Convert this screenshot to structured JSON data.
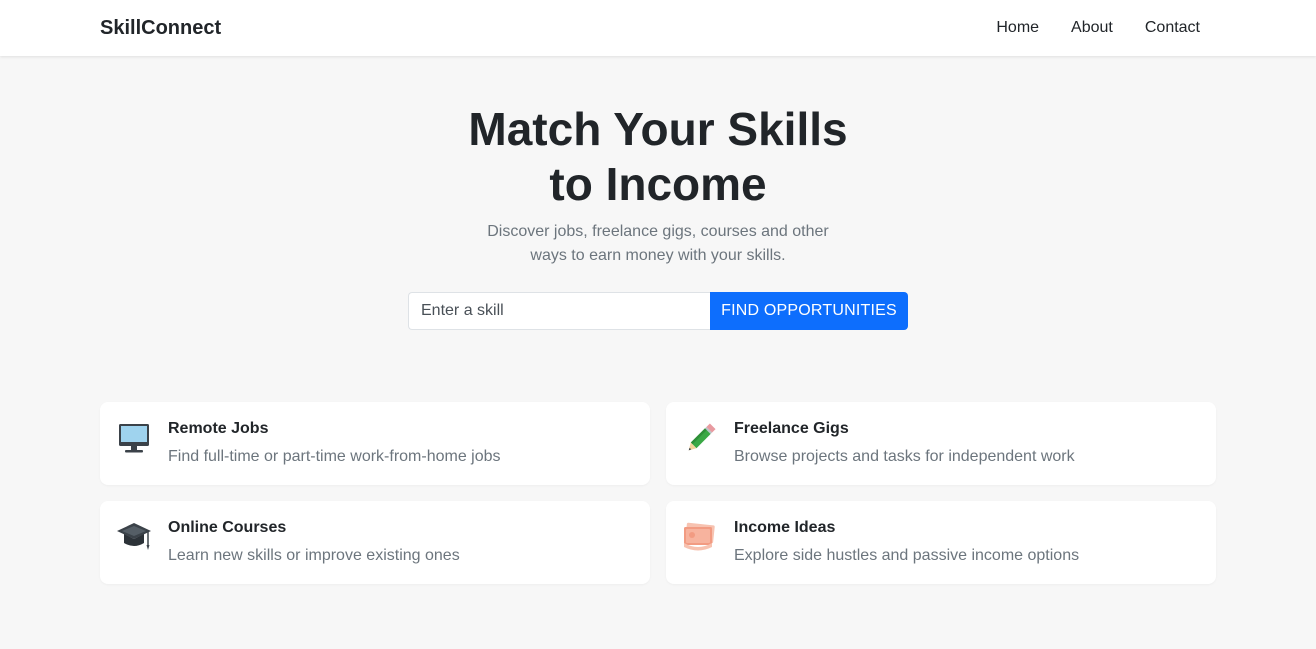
{
  "nav": {
    "brand": "SkillConnect",
    "links": [
      "Home",
      "About",
      "Contact"
    ]
  },
  "hero": {
    "title_line1": "Match Your Skills",
    "title_line2": "to Income",
    "subtitle_line1": "Discover jobs, freelance gigs, courses and other",
    "subtitle_line2": "ways to earn money with your skills."
  },
  "search": {
    "placeholder": "Enter a skill",
    "value": "",
    "button_label": "FIND OPPORTUNITIES"
  },
  "cards": [
    {
      "icon": "monitor-icon",
      "title": "Remote Jobs",
      "description": "Find full-time or part-time work-from-home jobs"
    },
    {
      "icon": "pencil-icon",
      "title": "Freelance Gigs",
      "description": "Browse projects and tasks for independent work"
    },
    {
      "icon": "graduation-cap-icon",
      "title": "Online Courses",
      "description": "Learn new skills or improve existing ones"
    },
    {
      "icon": "money-icon",
      "title": "Income Ideas",
      "description": "Explore side hustles and passive income options"
    }
  ],
  "colors": {
    "accent": "#0d6efd",
    "background": "#f7f7f7",
    "text": "#212529",
    "muted": "#6c757d"
  }
}
